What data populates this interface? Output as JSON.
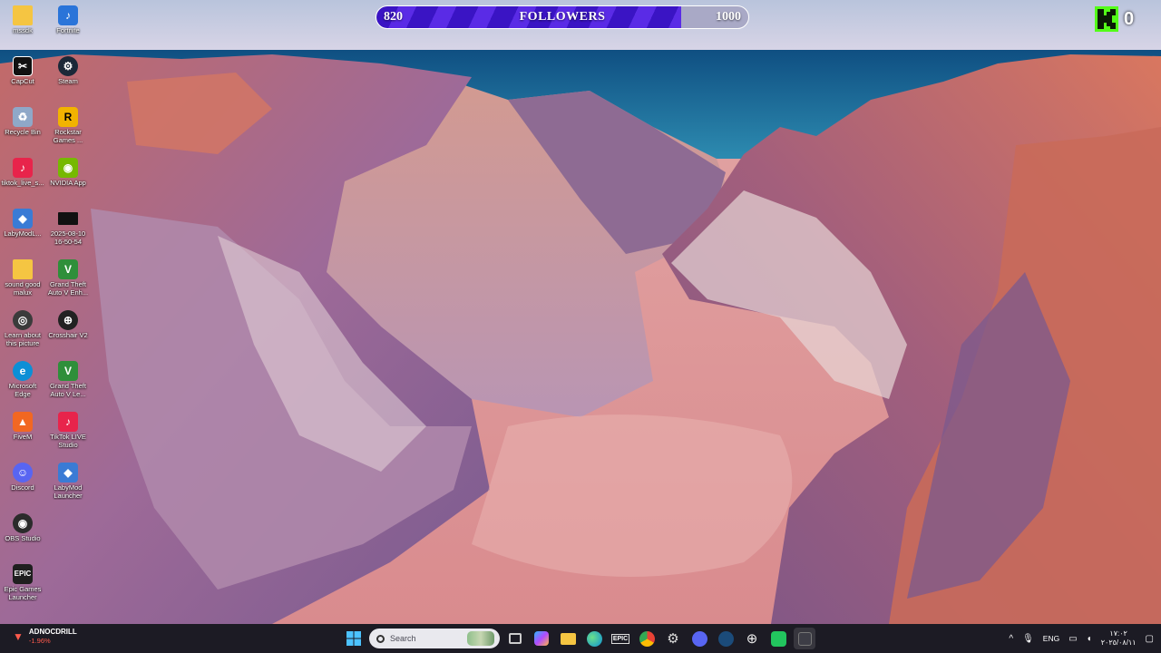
{
  "desktop_icons": [
    {
      "label": "mssdk",
      "icon": "folder-icon",
      "color": "#f5c542"
    },
    {
      "label": "Fortnite",
      "icon": "fortnite-icon",
      "color": "#2a74d9"
    },
    {
      "label": "CapCut",
      "icon": "capcut-icon",
      "color": "#111111"
    },
    {
      "label": "Steam",
      "icon": "steam-icon",
      "color": "#1b2838"
    },
    {
      "label": "Recycle Bin",
      "icon": "recycle-bin-icon",
      "color": "#8fa8c8"
    },
    {
      "label": "Rockstar Games ...",
      "icon": "rockstar-icon",
      "color": "#f2b300"
    },
    {
      "label": "tiktok_live_s...",
      "icon": "tiktok-live-icon",
      "color": "#e8244b"
    },
    {
      "label": "NVIDIA App",
      "icon": "nvidia-icon",
      "color": "#76b900"
    },
    {
      "label": "LabyModL...",
      "icon": "labymod-icon",
      "color": "#3a7bd5"
    },
    {
      "label": "2025-08-10 16-50-54",
      "icon": "video-file-icon",
      "color": "#111111"
    },
    {
      "label": "sound good malux",
      "icon": "folder-icon",
      "color": "#f5c542"
    },
    {
      "label": "Grand Theft Auto V Enh...",
      "icon": "gta-v-icon",
      "color": "#2f8f3a"
    },
    {
      "label": "Learn about this picture",
      "icon": "learn-picture-icon",
      "color": "#3b3b3b"
    },
    {
      "label": "Crosshair V2",
      "icon": "crosshair-icon",
      "color": "#222222"
    },
    {
      "label": "Microsoft Edge",
      "icon": "edge-icon",
      "color": "#0c8fd6"
    },
    {
      "label": "Grand Theft Auto V Le...",
      "icon": "gta-v-icon",
      "color": "#2f8f3a"
    },
    {
      "label": "FiveM",
      "icon": "fivem-icon",
      "color": "#f26722"
    },
    {
      "label": "TikTok LIVE Studio",
      "icon": "tiktok-studio-icon",
      "color": "#e8244b"
    },
    {
      "label": "Discord",
      "icon": "discord-icon",
      "color": "#5865f2"
    },
    {
      "label": "LabyMod Launcher",
      "icon": "labymod-icon",
      "color": "#3a7bd5"
    },
    {
      "label": "OBS Studio",
      "icon": "obs-icon",
      "color": "#2b2b2b"
    },
    {
      "label": "Epic Games Launcher",
      "icon": "epic-games-icon",
      "color": "#1f1f1f"
    }
  ],
  "follower_goal": {
    "current": "820",
    "goal": "1000",
    "caption": "FOLLOWERS",
    "progress": 0.82,
    "fill_color": "#4a1fd6"
  },
  "kick": {
    "count": "0",
    "color": "#53fc18"
  },
  "taskbar": {
    "stock_symbol": "ADNOCDRILL",
    "stock_change": "-1.96%",
    "search_placeholder": "Search",
    "apps": [
      "start-icon",
      "task-view-icon",
      "copilot-icon",
      "file-explorer-icon",
      "edge-icon",
      "epic-games-icon",
      "chrome-icon",
      "settings-icon",
      "discord-icon",
      "steam-icon",
      "crosshair-icon",
      "spotify-icon",
      "terminal-icon"
    ],
    "language": "ENG",
    "time": "١٧:٠٢",
    "date": "٢٠٢٥/٠٨/١١"
  }
}
